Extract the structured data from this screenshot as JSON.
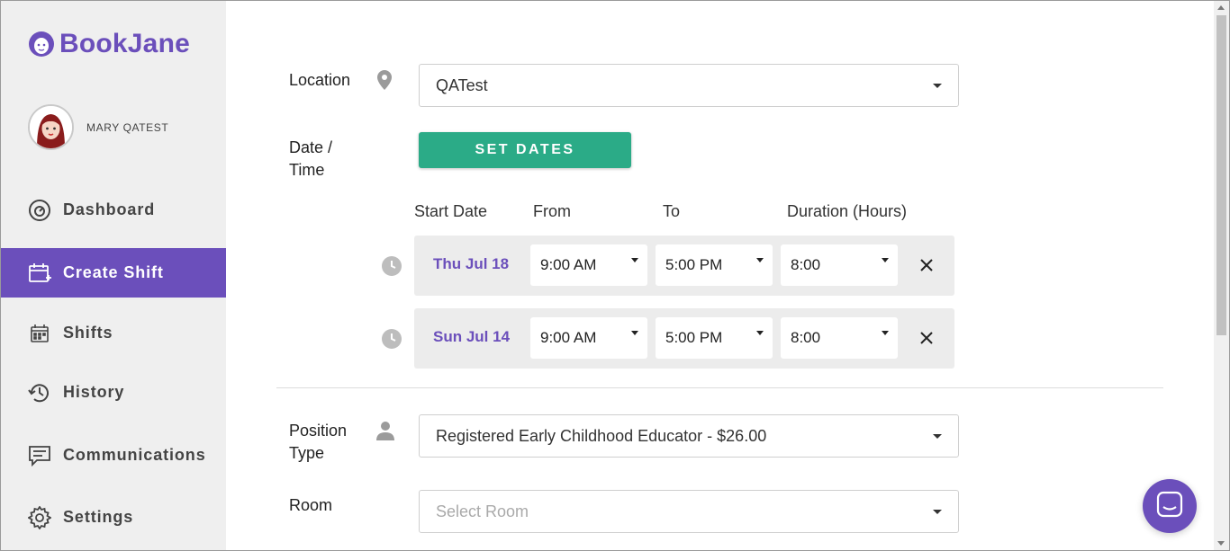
{
  "brand": {
    "name": "BookJane",
    "color": "#6b4fbb"
  },
  "user": {
    "name": "MARY QATEST"
  },
  "nav": {
    "dashboard": "Dashboard",
    "create_shift": "Create Shift",
    "shifts": "Shifts",
    "history": "History",
    "communications": "Communications",
    "settings": "Settings",
    "active": "create_shift"
  },
  "form": {
    "location_label": "Location",
    "location_value": "QATest",
    "datetime_label_1": "Date /",
    "datetime_label_2": "Time",
    "set_dates_button": "SET DATES",
    "columns": {
      "start_date": "Start Date",
      "from": "From",
      "to": "To",
      "duration": "Duration (Hours)"
    },
    "rows": [
      {
        "date": "Thu Jul 18",
        "from": "9:00 AM",
        "to": "5:00 PM",
        "duration": "8:00"
      },
      {
        "date": "Sun Jul 14",
        "from": "9:00 AM",
        "to": "5:00 PM",
        "duration": "8:00"
      }
    ],
    "position_label_1": "Position",
    "position_label_2": "Type",
    "position_value": "Registered Early Childhood Educator - $26.00",
    "room_label": "Room",
    "room_placeholder": "Select Room"
  },
  "colors": {
    "accent": "#6b4fbb",
    "button_green": "#2bab87",
    "row_bg": "#ececec"
  }
}
